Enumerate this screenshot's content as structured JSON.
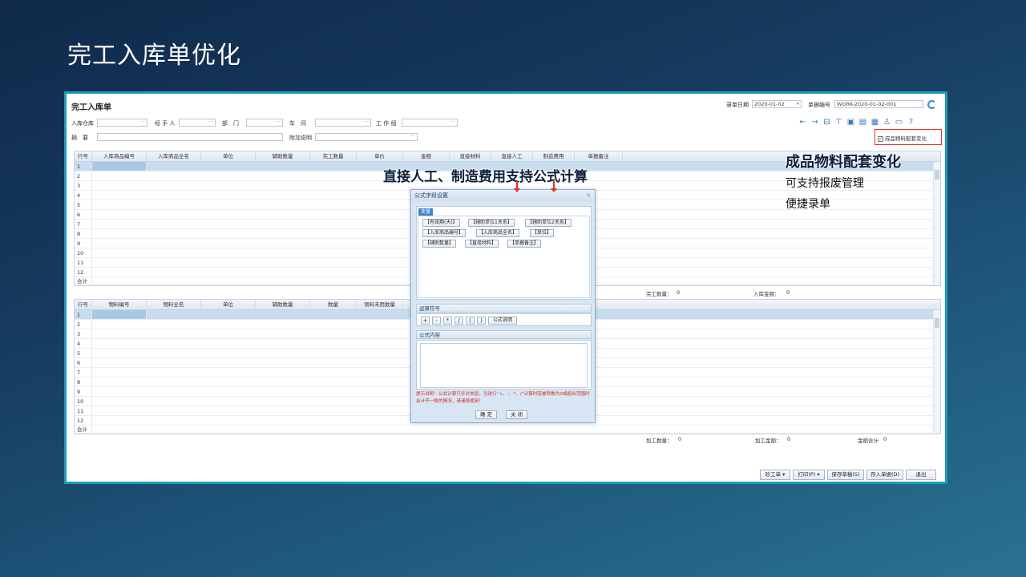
{
  "slide": {
    "title": "完工入库单优化"
  },
  "app": {
    "title": "完工入库单",
    "record_date_label": "录单日期",
    "record_date_value": "2020-01-02",
    "doc_no_label": "单据编号",
    "doc_no_value": "WGRK-2020-01-02-001",
    "labels": {
      "warehouse": "入库仓库",
      "handler": "经 手 人",
      "department": "部　门",
      "workshop": "车　间",
      "workgroup": "工 作 组",
      "summary": "摘　要",
      "extra": "附加说明"
    },
    "checkbox_label": "成品物料配套变化",
    "grid1": {
      "headers": [
        "行号",
        "入库商品编号",
        "入库商品全名",
        "单位",
        "辅助数量",
        "完工数量",
        "单价",
        "金额",
        "直接材料",
        "直接人工",
        "制造费用",
        "单据备注"
      ],
      "rows": [
        "1",
        "2",
        "3",
        "4",
        "5",
        "6",
        "7",
        "8",
        "9",
        "10",
        "11",
        "12"
      ],
      "total_label": "合计",
      "summary": {
        "complete_qty_label": "完工数量：",
        "complete_qty_value": "0",
        "stock_amount_label": "入库金额：",
        "stock_amount_value": "0"
      }
    },
    "grid2": {
      "headers": [
        "行号",
        "物料编号",
        "物料全名",
        "单位",
        "辅助数量",
        "数量",
        "领料未用数量"
      ],
      "rows": [
        "1",
        "2",
        "3",
        "4",
        "5",
        "6",
        "7",
        "8",
        "9",
        "10",
        "11",
        "12"
      ],
      "total_label": "合计",
      "summary": {
        "process_qty_label": "加工数量：",
        "process_qty_value": "0",
        "process_amount_label": "加工金额：",
        "process_amount_value": "0",
        "total_amount_label": "金额合计",
        "total_amount_value": "0"
      }
    },
    "buttons": {
      "rework": "珍工单 ▾",
      "print": "打印(P) ▾",
      "save_draft": "保存草稿(S)",
      "post": "存入单据(D)",
      "exit": "退出"
    }
  },
  "dialog": {
    "title": "公式字段设置",
    "close": "✕",
    "tab": "变量",
    "variables": [
      "【有效期(天)】",
      "【辅助单位1关系】",
      "【辅助单位2关系】",
      "【入库商品编号】",
      "【入库商品全名】",
      "【单位】",
      "【辅助数量】",
      "【直接材料】",
      "【单据备注】"
    ],
    "operators_title": "运算符号",
    "operators": [
      "+",
      "-",
      "*",
      "/",
      "(",
      ")"
    ],
    "formula_help": "公式说明",
    "formula_content_title": "公式内容",
    "hint": "提示说明：公式计算只针对本层，当进行“+、-、*、/”计算时若被除数为0或超出范围时会计不一致的情况，请谨慎使用！",
    "ok": "确 定",
    "cancel": "关 闭"
  },
  "callouts": {
    "middle": "直接人工、制造费用支持公式计算",
    "right_title": "成品物料配套变化",
    "right_lines": [
      "可支持报废管理",
      "便捷录单"
    ]
  }
}
